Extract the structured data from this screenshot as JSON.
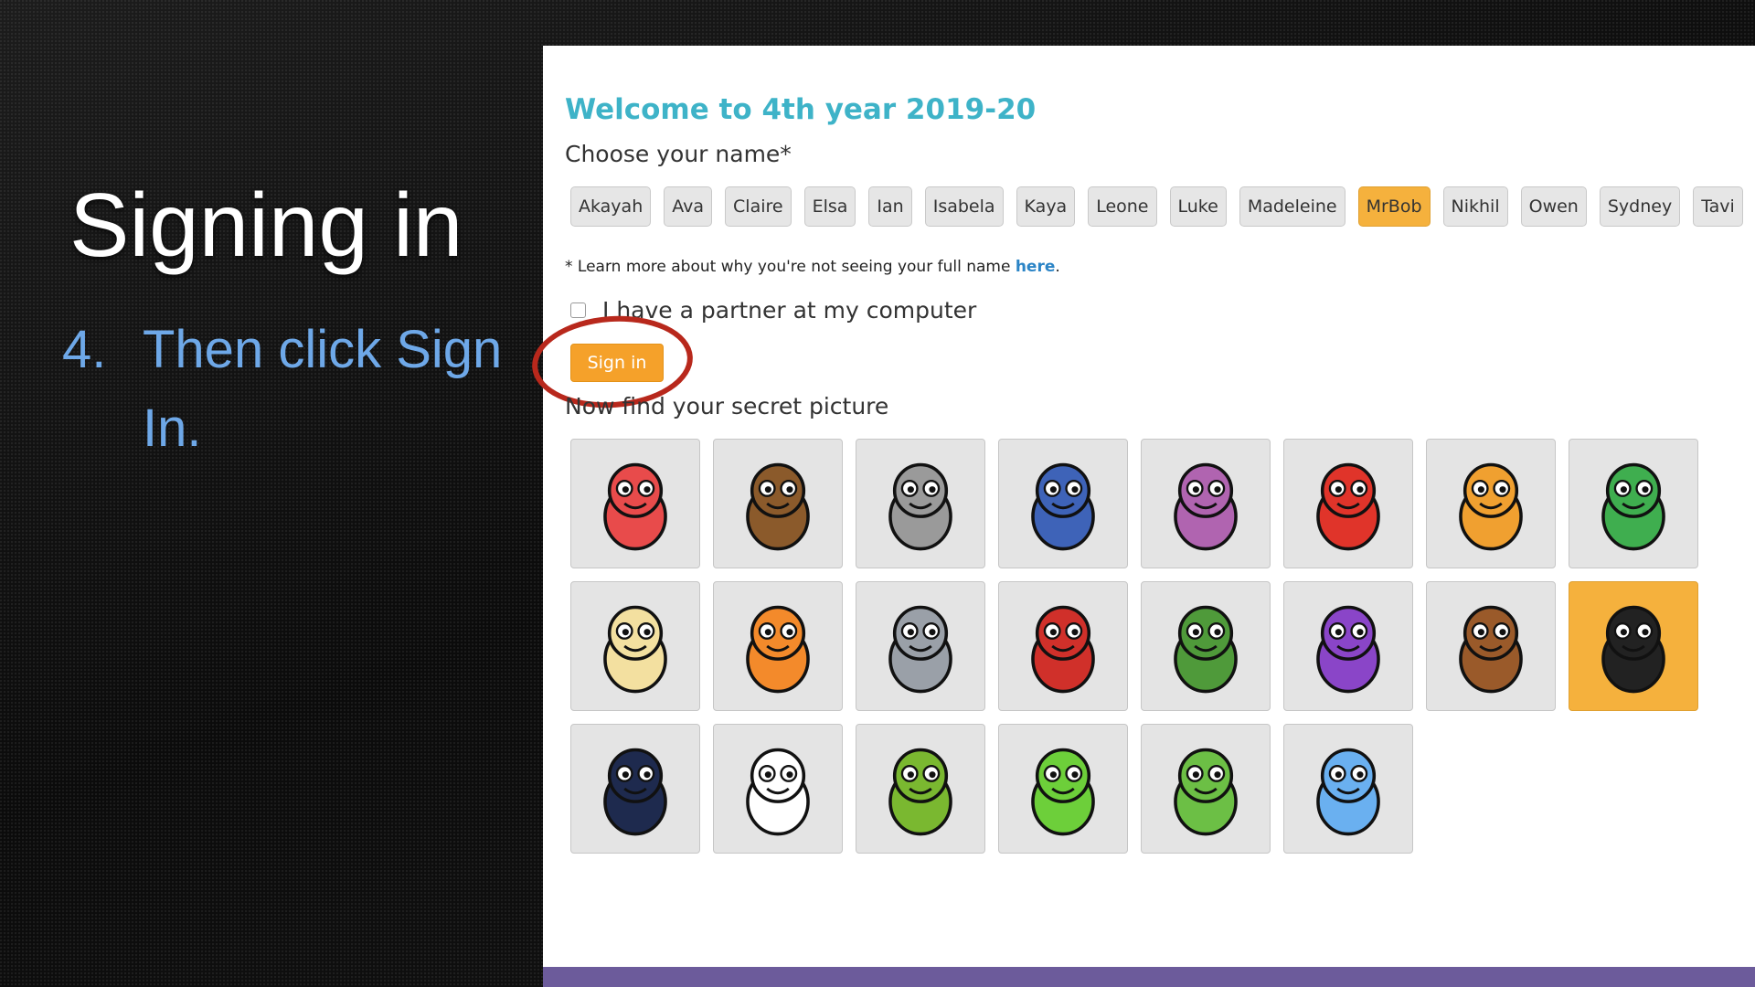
{
  "slide": {
    "title": "Signing in",
    "step_number": "4.",
    "step_text": "Then click Sign In."
  },
  "app": {
    "welcome": "Welcome to 4th year 2019-20",
    "choose_label": "Choose your name*",
    "names": [
      "Akayah",
      "Ava",
      "Claire",
      "Elsa",
      "Ian",
      "Isabela",
      "Kaya",
      "Leone",
      "Luke",
      "Madeleine",
      "MrBob",
      "Nikhil",
      "Owen",
      "Sydney",
      "Tavi"
    ],
    "selected_name": "MrBob",
    "note_text": "* Learn more about why you're not seeing your full name ",
    "note_link": "here",
    "note_end": ".",
    "partner_label": "I have a partner at my computer",
    "partner_checked": false,
    "signin_label": "Sign in",
    "find_label": "Now find your secret picture",
    "selected_picture": "penguin",
    "pictures": [
      {
        "icon": "red-monster-icon",
        "color": "#e84b4b"
      },
      {
        "icon": "princess-icon",
        "color": "#8b5a2b"
      },
      {
        "icon": "hamster-icon",
        "color": "#9a9a9a"
      },
      {
        "icon": "wizard-icon",
        "color": "#3e63b8"
      },
      {
        "icon": "bat-icon",
        "color": "#b064b0"
      },
      {
        "icon": "red-bird-icon",
        "color": "#e0342a"
      },
      {
        "icon": "knight-icon",
        "color": "#f0a030"
      },
      {
        "icon": "witch-icon",
        "color": "#3fae4f"
      },
      {
        "icon": "dog-icon",
        "color": "#f3e0a0"
      },
      {
        "icon": "cat-icon",
        "color": "#f38a2b"
      },
      {
        "icon": "robot-icon",
        "color": "#9aa0a8"
      },
      {
        "icon": "pirate-icon",
        "color": "#d0302a"
      },
      {
        "icon": "green-robot-icon",
        "color": "#4f9a3a"
      },
      {
        "icon": "purple-dragon-icon",
        "color": "#8a45c8"
      },
      {
        "icon": "unicorn-icon",
        "color": "#9a5a2a"
      },
      {
        "icon": "penguin-icon",
        "color": "#222222"
      },
      {
        "icon": "ninja-icon",
        "color": "#1e2a4e"
      },
      {
        "icon": "ghost-icon",
        "color": "#ffffff"
      },
      {
        "icon": "zombie-icon",
        "color": "#7ab830"
      },
      {
        "icon": "alien-icon",
        "color": "#6dcf3a"
      },
      {
        "icon": "frog-icon",
        "color": "#6cbf45"
      },
      {
        "icon": "octopus-icon",
        "color": "#6ab0f0"
      }
    ]
  },
  "colors": {
    "accent": "#3eb3c8",
    "selected": "#f5b13d",
    "signin": "#f5a12a",
    "annotation": "#b8281c",
    "footer": "#6c5b9b"
  }
}
